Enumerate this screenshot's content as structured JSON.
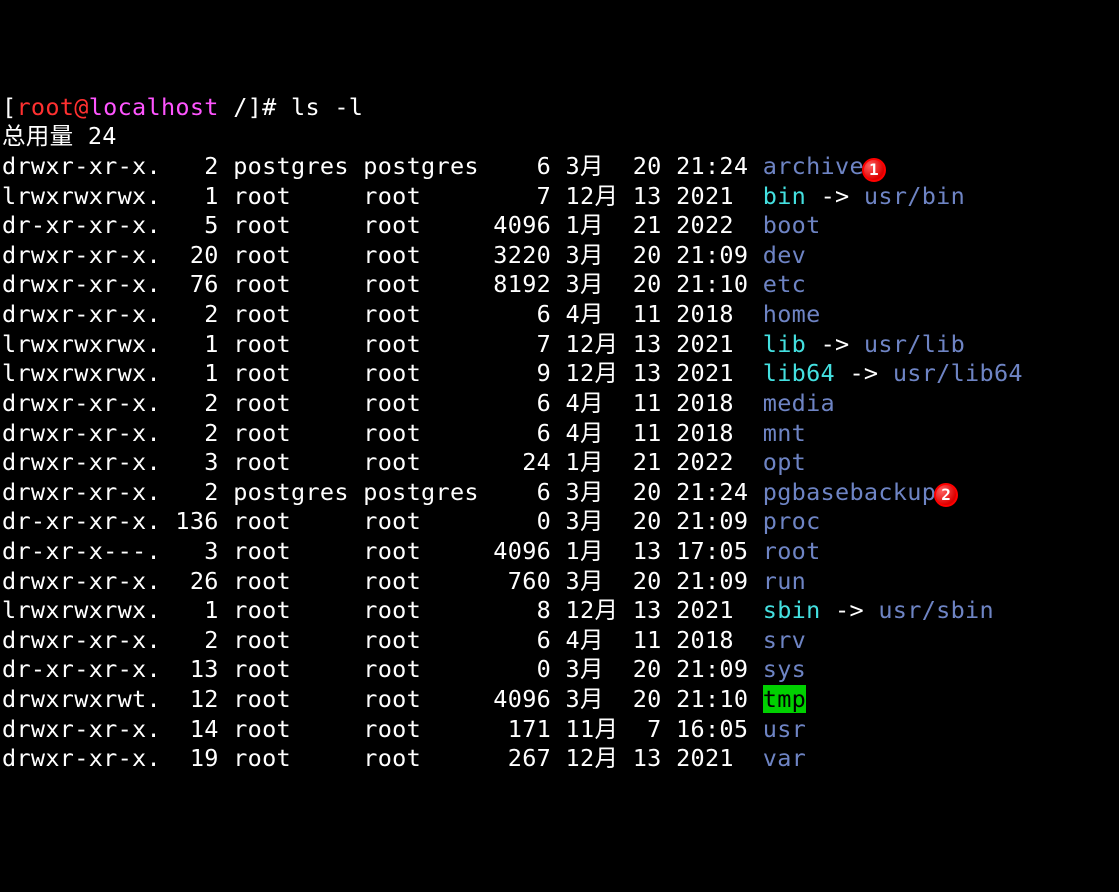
{
  "prompt": {
    "bracket_open": "[",
    "user": "root",
    "at": "@",
    "host": "localhost",
    "path_sep": " /]",
    "hash": "# ",
    "command": "ls -l"
  },
  "total_line": "总用量 24",
  "rows": [
    {
      "perm": "drwxr-xr-x.",
      "links": "  2",
      "owner": "postgres",
      "group": "postgres",
      "size": "   6",
      "month": "3月 ",
      "day": "20",
      "time": "21:24",
      "name": "archive",
      "type": "dir",
      "annot": "1"
    },
    {
      "perm": "lrwxrwxrwx.",
      "links": "  1",
      "owner": "root    ",
      "group": "root    ",
      "size": "   7",
      "month": "12月",
      "day": "13",
      "time": "2021 ",
      "name": "bin",
      "type": "link",
      "target": "usr/bin"
    },
    {
      "perm": "dr-xr-xr-x.",
      "links": "  5",
      "owner": "root    ",
      "group": "root    ",
      "size": "4096",
      "month": "1月 ",
      "day": "21",
      "time": "2022 ",
      "name": "boot",
      "type": "dir"
    },
    {
      "perm": "drwxr-xr-x.",
      "links": " 20",
      "owner": "root    ",
      "group": "root    ",
      "size": "3220",
      "month": "3月 ",
      "day": "20",
      "time": "21:09",
      "name": "dev",
      "type": "dir"
    },
    {
      "perm": "drwxr-xr-x.",
      "links": " 76",
      "owner": "root    ",
      "group": "root    ",
      "size": "8192",
      "month": "3月 ",
      "day": "20",
      "time": "21:10",
      "name": "etc",
      "type": "dir"
    },
    {
      "perm": "drwxr-xr-x.",
      "links": "  2",
      "owner": "root    ",
      "group": "root    ",
      "size": "   6",
      "month": "4月 ",
      "day": "11",
      "time": "2018 ",
      "name": "home",
      "type": "dir"
    },
    {
      "perm": "lrwxrwxrwx.",
      "links": "  1",
      "owner": "root    ",
      "group": "root    ",
      "size": "   7",
      "month": "12月",
      "day": "13",
      "time": "2021 ",
      "name": "lib",
      "type": "link",
      "target": "usr/lib"
    },
    {
      "perm": "lrwxrwxrwx.",
      "links": "  1",
      "owner": "root    ",
      "group": "root    ",
      "size": "   9",
      "month": "12月",
      "day": "13",
      "time": "2021 ",
      "name": "lib64",
      "type": "link",
      "target": "usr/lib64"
    },
    {
      "perm": "drwxr-xr-x.",
      "links": "  2",
      "owner": "root    ",
      "group": "root    ",
      "size": "   6",
      "month": "4月 ",
      "day": "11",
      "time": "2018 ",
      "name": "media",
      "type": "dir"
    },
    {
      "perm": "drwxr-xr-x.",
      "links": "  2",
      "owner": "root    ",
      "group": "root    ",
      "size": "   6",
      "month": "4月 ",
      "day": "11",
      "time": "2018 ",
      "name": "mnt",
      "type": "dir"
    },
    {
      "perm": "drwxr-xr-x.",
      "links": "  3",
      "owner": "root    ",
      "group": "root    ",
      "size": "  24",
      "month": "1月 ",
      "day": "21",
      "time": "2022 ",
      "name": "opt",
      "type": "dir"
    },
    {
      "perm": "drwxr-xr-x.",
      "links": "  2",
      "owner": "postgres",
      "group": "postgres",
      "size": "   6",
      "month": "3月 ",
      "day": "20",
      "time": "21:24",
      "name": "pgbasebackup",
      "type": "dir",
      "annot": "2"
    },
    {
      "perm": "dr-xr-xr-x.",
      "links": "136",
      "owner": "root    ",
      "group": "root    ",
      "size": "   0",
      "month": "3月 ",
      "day": "20",
      "time": "21:09",
      "name": "proc",
      "type": "dir"
    },
    {
      "perm": "dr-xr-x---.",
      "links": "  3",
      "owner": "root    ",
      "group": "root    ",
      "size": "4096",
      "month": "1月 ",
      "day": "13",
      "time": "17:05",
      "name": "root",
      "type": "dir"
    },
    {
      "perm": "drwxr-xr-x.",
      "links": " 26",
      "owner": "root    ",
      "group": "root    ",
      "size": " 760",
      "month": "3月 ",
      "day": "20",
      "time": "21:09",
      "name": "run",
      "type": "dir"
    },
    {
      "perm": "lrwxrwxrwx.",
      "links": "  1",
      "owner": "root    ",
      "group": "root    ",
      "size": "   8",
      "month": "12月",
      "day": "13",
      "time": "2021 ",
      "name": "sbin",
      "type": "link",
      "target": "usr/sbin"
    },
    {
      "perm": "drwxr-xr-x.",
      "links": "  2",
      "owner": "root    ",
      "group": "root    ",
      "size": "   6",
      "month": "4月 ",
      "day": "11",
      "time": "2018 ",
      "name": "srv",
      "type": "dir"
    },
    {
      "perm": "dr-xr-xr-x.",
      "links": " 13",
      "owner": "root    ",
      "group": "root    ",
      "size": "   0",
      "month": "3月 ",
      "day": "20",
      "time": "21:09",
      "name": "sys",
      "type": "dir"
    },
    {
      "perm": "drwxrwxrwt.",
      "links": " 12",
      "owner": "root    ",
      "group": "root    ",
      "size": "4096",
      "month": "3月 ",
      "day": "20",
      "time": "21:10",
      "name": "tmp",
      "type": "sticky"
    },
    {
      "perm": "drwxr-xr-x.",
      "links": " 14",
      "owner": "root    ",
      "group": "root    ",
      "size": " 171",
      "month": "11月",
      "day": " 7",
      "time": "16:05",
      "name": "usr",
      "type": "dir"
    },
    {
      "perm": "drwxr-xr-x.",
      "links": " 19",
      "owner": "root    ",
      "group": "root    ",
      "size": " 267",
      "month": "12月",
      "day": "13",
      "time": "2021 ",
      "name": "var",
      "type": "dir"
    }
  ]
}
